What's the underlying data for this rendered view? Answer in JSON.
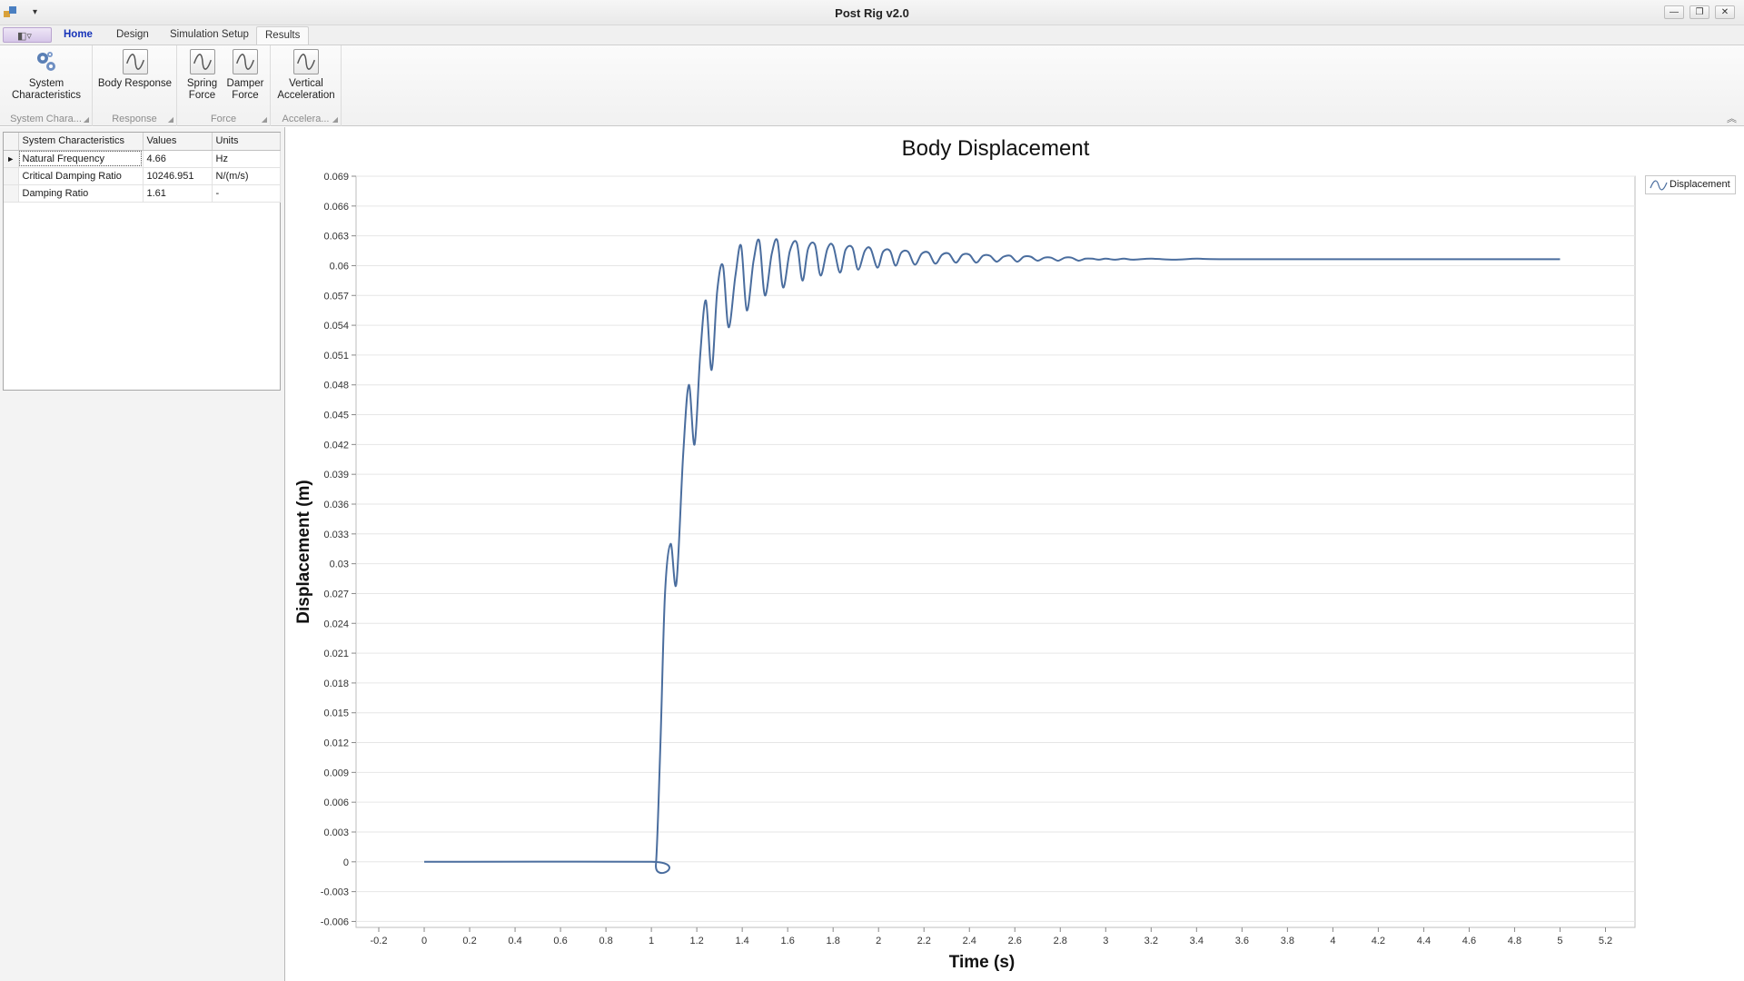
{
  "window": {
    "title": "Post Rig v2.0",
    "qat_dropdown": "▾",
    "controls": {
      "minimize": "—",
      "restore": "❐",
      "close": "✕"
    }
  },
  "tabs": [
    {
      "label": "Home",
      "state": "active"
    },
    {
      "label": "Design",
      "state": ""
    },
    {
      "label": "Simulation Setup",
      "state": ""
    },
    {
      "label": "Results",
      "state": "selected"
    }
  ],
  "ribbon": {
    "groups": [
      {
        "label": "System Chara...",
        "buttons": [
          {
            "label": "System\nCharacteristics",
            "icon": "gear-icon"
          }
        ]
      },
      {
        "label": "Response",
        "buttons": [
          {
            "label": "Body Response",
            "icon": "wave-icon"
          }
        ]
      },
      {
        "label": "Force",
        "buttons": [
          {
            "label": "Spring\nForce",
            "icon": "wave-icon"
          },
          {
            "label": "Damper\nForce",
            "icon": "wave-icon"
          }
        ]
      },
      {
        "label": "Accelera...",
        "buttons": [
          {
            "label": "Vertical\nAcceleration",
            "icon": "wave-icon"
          }
        ]
      }
    ],
    "collapse_icon": "chevron-up-icon"
  },
  "grid": {
    "headers": [
      "System Characteristics",
      "Values",
      "Units"
    ],
    "rows": [
      {
        "name": "Natural Frequency",
        "value": "4.66",
        "unit": "Hz",
        "current": true
      },
      {
        "name": "Critical Damping Ratio",
        "value": "10246.951",
        "unit": "N/(m/s)",
        "current": false
      },
      {
        "name": "Damping Ratio",
        "value": "1.61",
        "unit": "-",
        "current": false
      }
    ]
  },
  "chart_data": {
    "type": "line",
    "title": "Body Displacement",
    "xlabel": "Time (s)",
    "ylabel": "Displacement (m)",
    "xlim": [
      -0.3,
      5.33
    ],
    "ylim": [
      -0.0066,
      0.069
    ],
    "x_ticks": [
      "-0.2",
      "0",
      "0.2",
      "0.4",
      "0.6",
      "0.8",
      "1",
      "1.2",
      "1.4",
      "1.6",
      "1.8",
      "2",
      "2.2",
      "2.4",
      "2.6",
      "2.8",
      "3",
      "3.2",
      "3.4",
      "3.6",
      "3.8",
      "4",
      "4.2",
      "4.4",
      "4.6",
      "4.8",
      "5",
      "5.2"
    ],
    "y_ticks": [
      "-0.006",
      "-0.003",
      "0",
      "0.003",
      "0.006",
      "0.009",
      "0.012",
      "0.015",
      "0.018",
      "0.021",
      "0.024",
      "0.027",
      "0.03",
      "0.033",
      "0.036",
      "0.039",
      "0.042",
      "0.045",
      "0.048",
      "0.051",
      "0.054",
      "0.057",
      "0.06",
      "0.063",
      "0.066",
      "0.069"
    ],
    "grid": true,
    "legend_position": "top-right outside",
    "series": [
      {
        "name": "Displacement",
        "color": "#4a6d9e",
        "points": [
          [
            0,
            0
          ],
          [
            1.0,
            0
          ],
          [
            1.02,
            -0.0003
          ],
          [
            1.04,
            0.012
          ],
          [
            1.06,
            0.027
          ],
          [
            1.085,
            0.032
          ],
          [
            1.11,
            0.028
          ],
          [
            1.14,
            0.041
          ],
          [
            1.165,
            0.048
          ],
          [
            1.19,
            0.042
          ],
          [
            1.215,
            0.051
          ],
          [
            1.24,
            0.0565
          ],
          [
            1.265,
            0.0495
          ],
          [
            1.29,
            0.0575
          ],
          [
            1.315,
            0.06
          ],
          [
            1.34,
            0.0538
          ],
          [
            1.37,
            0.059
          ],
          [
            1.395,
            0.062
          ],
          [
            1.42,
            0.0555
          ],
          [
            1.45,
            0.0605
          ],
          [
            1.475,
            0.0625
          ],
          [
            1.5,
            0.057
          ],
          [
            1.53,
            0.0612
          ],
          [
            1.555,
            0.0625
          ],
          [
            1.58,
            0.0578
          ],
          [
            1.61,
            0.0615
          ],
          [
            1.64,
            0.0623
          ],
          [
            1.665,
            0.0585
          ],
          [
            1.69,
            0.0617
          ],
          [
            1.72,
            0.0621
          ],
          [
            1.745,
            0.059
          ],
          [
            1.775,
            0.0617
          ],
          [
            1.8,
            0.062
          ],
          [
            1.83,
            0.0593
          ],
          [
            1.855,
            0.0616
          ],
          [
            1.885,
            0.0618
          ],
          [
            1.91,
            0.0596
          ],
          [
            1.94,
            0.0615
          ],
          [
            1.965,
            0.0617
          ],
          [
            1.995,
            0.0598
          ],
          [
            2.02,
            0.0614
          ],
          [
            2.05,
            0.0615
          ],
          [
            2.075,
            0.06
          ],
          [
            2.1,
            0.0613
          ],
          [
            2.13,
            0.0614
          ],
          [
            2.16,
            0.0601
          ],
          [
            2.19,
            0.0612
          ],
          [
            2.22,
            0.0613
          ],
          [
            2.25,
            0.0602
          ],
          [
            2.28,
            0.0611
          ],
          [
            2.31,
            0.0612
          ],
          [
            2.34,
            0.0603
          ],
          [
            2.37,
            0.0611
          ],
          [
            2.4,
            0.0611
          ],
          [
            2.43,
            0.0603
          ],
          [
            2.46,
            0.061
          ],
          [
            2.49,
            0.061
          ],
          [
            2.52,
            0.0604
          ],
          [
            2.55,
            0.0609
          ],
          [
            2.58,
            0.061
          ],
          [
            2.61,
            0.0604
          ],
          [
            2.64,
            0.0609
          ],
          [
            2.67,
            0.0609
          ],
          [
            2.7,
            0.0605
          ],
          [
            2.73,
            0.0608
          ],
          [
            2.76,
            0.0608
          ],
          [
            2.79,
            0.0605
          ],
          [
            2.82,
            0.0608
          ],
          [
            2.85,
            0.0608
          ],
          [
            2.88,
            0.0605
          ],
          [
            2.91,
            0.0607
          ],
          [
            2.94,
            0.0607
          ],
          [
            2.97,
            0.0606
          ],
          [
            3.0,
            0.0607
          ],
          [
            3.04,
            0.0606
          ],
          [
            3.08,
            0.0607
          ],
          [
            3.12,
            0.0606
          ],
          [
            3.2,
            0.0607
          ],
          [
            3.3,
            0.0606
          ],
          [
            3.4,
            0.0607
          ],
          [
            3.5,
            0.06065
          ],
          [
            4.0,
            0.06065
          ],
          [
            4.5,
            0.06065
          ],
          [
            5.0,
            0.06065
          ]
        ]
      }
    ]
  }
}
